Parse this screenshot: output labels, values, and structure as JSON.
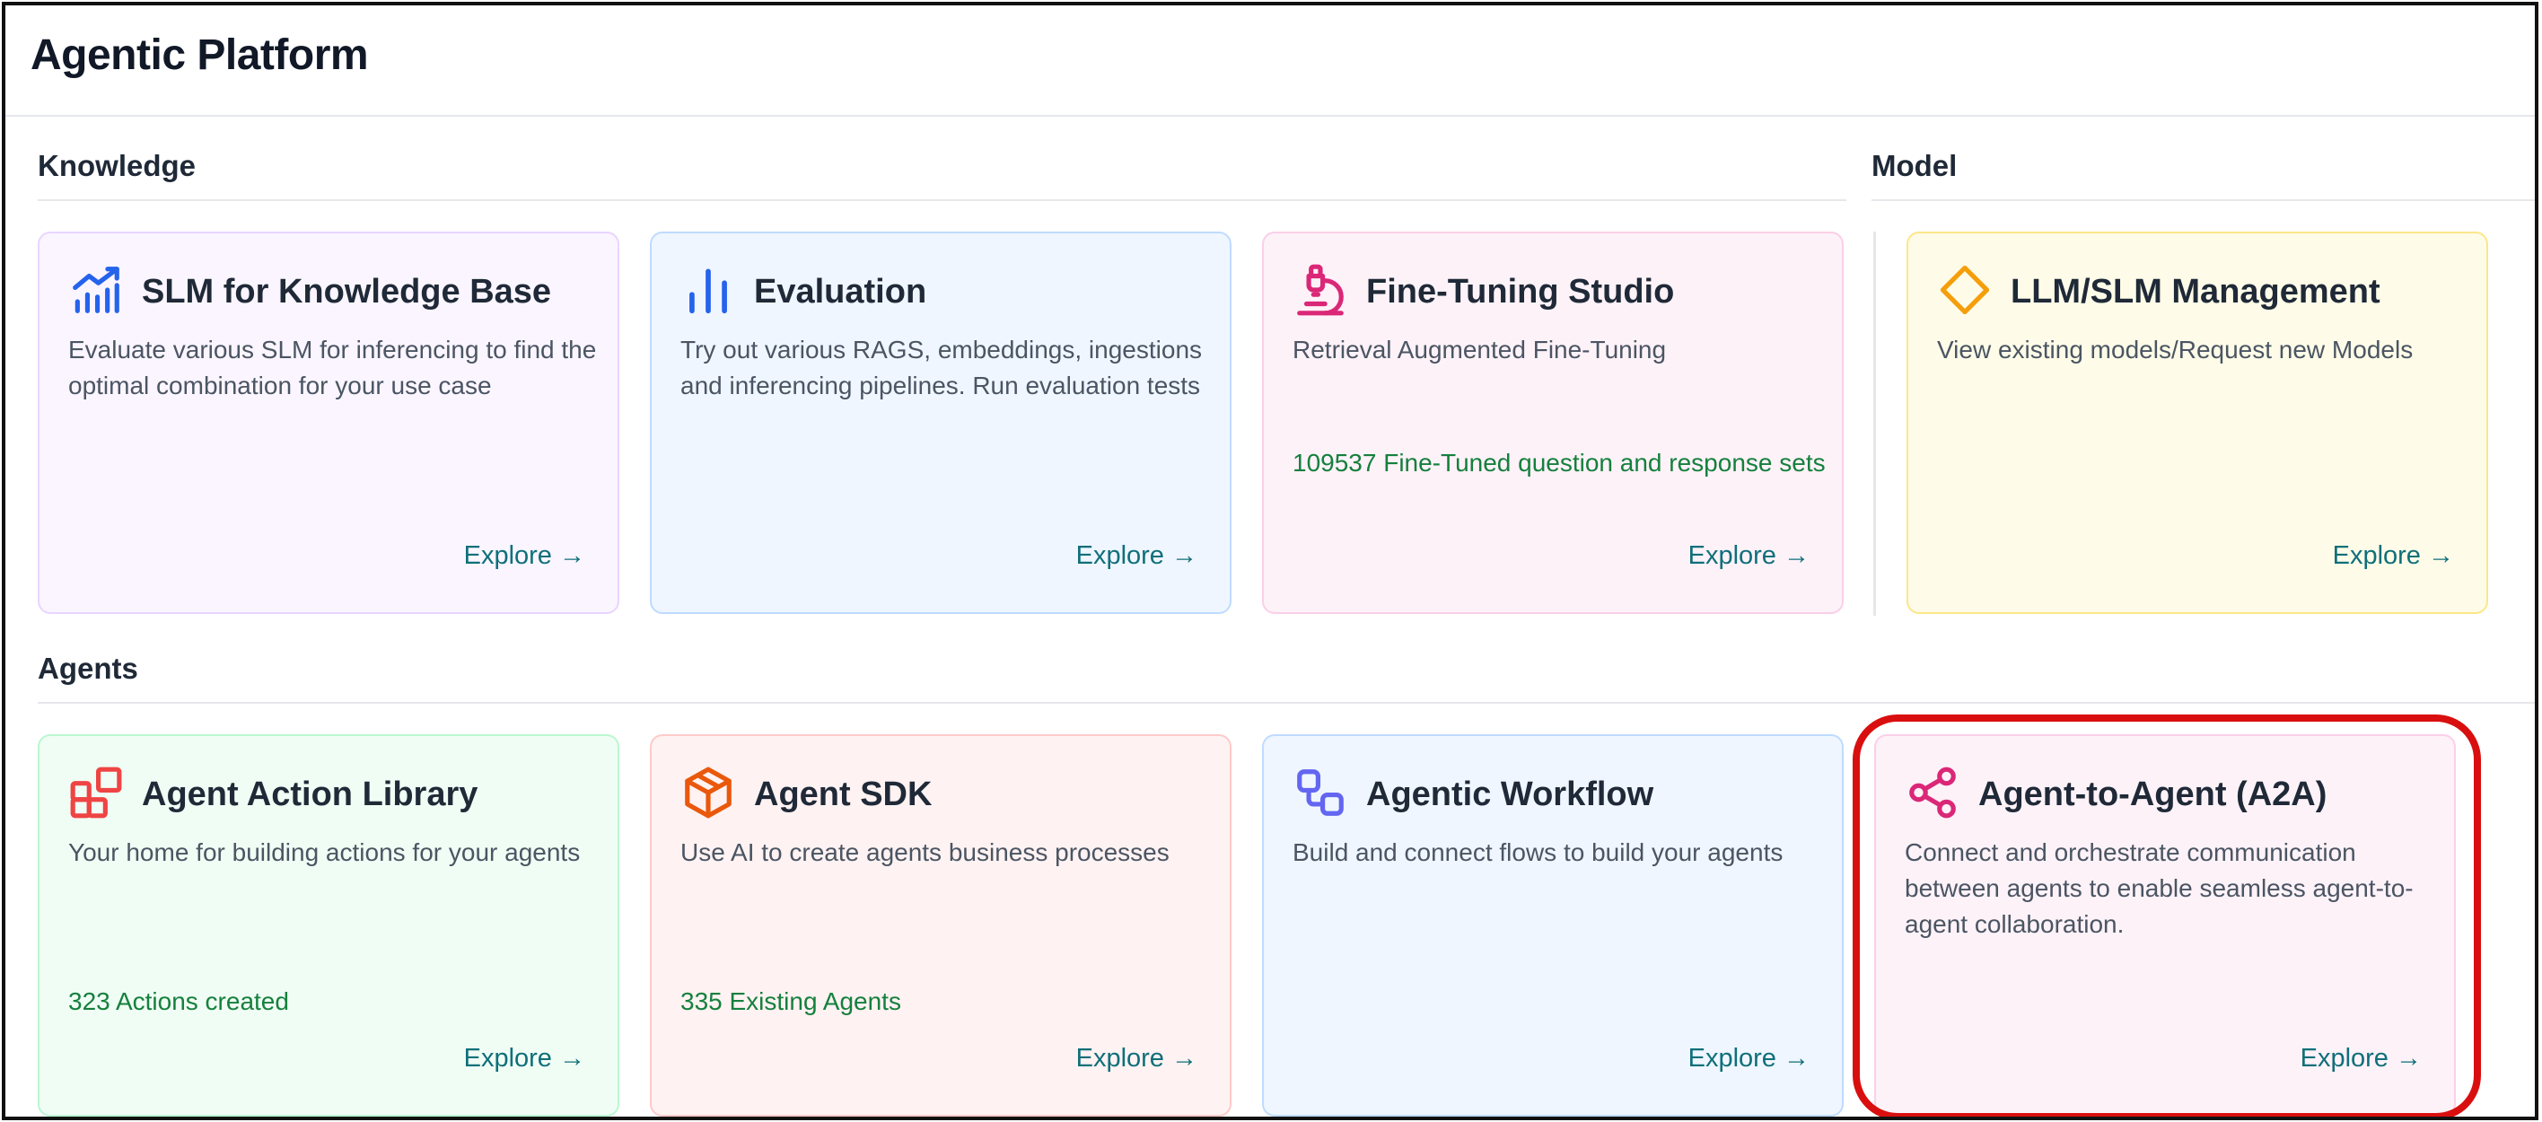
{
  "app": {
    "title": "Agentic Platform"
  },
  "sections": {
    "knowledge": "Knowledge",
    "model": "Model",
    "agents": "Agents"
  },
  "cards": {
    "slm": {
      "title": "SLM for Knowledge Base",
      "description": "Evaluate various SLM for inferencing to find the optimal combination for your use case",
      "explore": "Explore →",
      "icon": "bar-chart-trend-icon",
      "accent": "#2563eb"
    },
    "evaluation": {
      "title": "Evaluation",
      "description": "Try out various RAGS, embeddings, ingestions and inferencing pipelines. Run evaluation tests",
      "explore": "Explore →",
      "icon": "vertical-bars-icon",
      "accent": "#2563eb"
    },
    "finetuning": {
      "title": "Fine-Tuning Studio",
      "description": "Retrieval Augmented Fine-Tuning",
      "stat": "109537 Fine-Tuned question and response sets",
      "explore": "Explore →",
      "icon": "microscope-icon",
      "accent": "#db2777"
    },
    "llm": {
      "title": "LLM/SLM Management",
      "description": "View existing models/Request new Models",
      "explore": "Explore →",
      "icon": "diamond-icon",
      "accent": "#f59e0b"
    },
    "action_library": {
      "title": "Agent Action Library",
      "description": "Your home for building actions for your agents",
      "stat": "323 Actions created",
      "explore": "Explore →",
      "icon": "blocks-icon",
      "accent": "#ef4444"
    },
    "sdk": {
      "title": "Agent SDK",
      "description": "Use AI to create agents business processes",
      "stat": "335 Existing Agents",
      "explore": "Explore →",
      "icon": "package-icon",
      "accent": "#ea580c"
    },
    "workflow": {
      "title": "Agentic Workflow",
      "description": "Build and connect flows to build your agents",
      "explore": "Explore →",
      "icon": "workflow-icon",
      "accent": "#6366f1"
    },
    "a2a": {
      "title": "Agent-to-Agent (A2A)",
      "description": "Connect and orchestrate communication between agents to enable seamless agent-to-agent collaboration.",
      "explore": "Explore →",
      "icon": "share-nodes-icon",
      "accent": "#db2777"
    }
  },
  "colors": {
    "explore_link": "#0f6f7a",
    "stat_text": "#15803d",
    "highlight": "#d90f0f"
  }
}
